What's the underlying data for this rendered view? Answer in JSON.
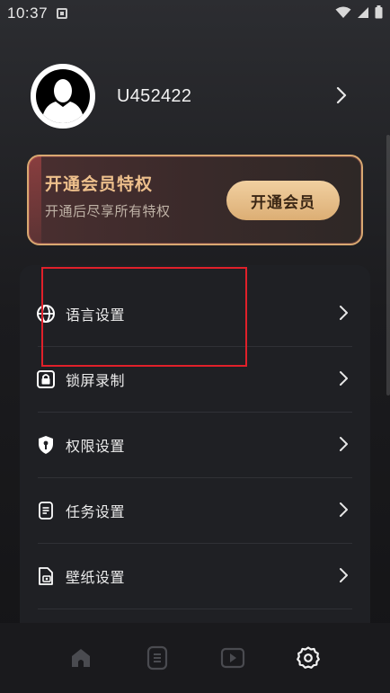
{
  "status_bar": {
    "time": "10:37",
    "icons": [
      "notification-icon",
      "wifi-icon",
      "signal-icon",
      "battery-icon"
    ]
  },
  "profile": {
    "username": "U452422",
    "avatar_icon": "user-silhouette-icon"
  },
  "vip": {
    "title": "开通会员特权",
    "subtitle": "开通后尽享所有特权",
    "button_label": "开通会员",
    "accent_color": "#eec08c"
  },
  "menu": {
    "items": [
      {
        "label": "语言设置",
        "icon": "globe-icon"
      },
      {
        "label": "锁屏录制",
        "icon": "lock-screen-icon"
      },
      {
        "label": "权限设置",
        "icon": "shield-key-icon"
      },
      {
        "label": "任务设置",
        "icon": "task-list-icon"
      },
      {
        "label": "壁纸设置",
        "icon": "wallpaper-icon"
      }
    ]
  },
  "bottom_nav": {
    "items": [
      {
        "name": "home",
        "icon": "home-icon",
        "active": false
      },
      {
        "name": "list",
        "icon": "list-icon",
        "active": false
      },
      {
        "name": "video",
        "icon": "video-icon",
        "active": false
      },
      {
        "name": "settings",
        "icon": "gear-icon",
        "active": true
      }
    ]
  }
}
